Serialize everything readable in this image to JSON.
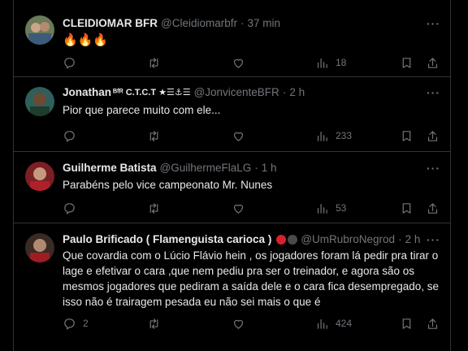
{
  "colors": {
    "background": "#000000",
    "border": "#2f3336",
    "text": "#e7e9ea",
    "muted": "#71767b",
    "accent_red": "#d8202f"
  },
  "action_icons": [
    "reply-icon",
    "retweet-icon",
    "like-icon",
    "views-icon",
    "bookmark-icon",
    "share-icon"
  ],
  "more_label": "···",
  "tweets": [
    {
      "name": "CLEIDIOMAR BFR",
      "handle": "@Cleidiomarbfr",
      "time": "37 min",
      "text": "🔥🔥🔥",
      "replies": "",
      "retweets": "",
      "likes": "",
      "views": "18"
    },
    {
      "name": "Jonathan",
      "name_badges": "ᴮᶠᴿ C.T.C.T ★☰⚓☰",
      "handle": "@JonvicenteBFR",
      "time": "2 h",
      "text": "Pior que parece muito com ele...",
      "replies": "",
      "retweets": "",
      "likes": "",
      "views": "233"
    },
    {
      "name": "Guilherme Batista",
      "handle": "@GuilhermeFlaLG",
      "time": "1 h",
      "text": "Parabéns pelo vice campeonato Mr. Nunes",
      "replies": "",
      "retweets": "",
      "likes": "",
      "views": "53"
    },
    {
      "name": "Paulo Brificado ( Flamenguista carioca )",
      "handle": "@UmRubroNegrod",
      "time": "2 h",
      "text": "Que covardia com o Lúcio Flávio hein , os jogadores foram lá pedir pra tirar o lage e efetivar o cara ,que nem pediu pra ser o treinador, e agora são os mesmos jogadores que pediram a saída dele e o cara fica desempregado, se isso não é trairagem pesada eu não sei mais o que é",
      "replies": "2",
      "retweets": "",
      "likes": "",
      "views": "424"
    }
  ]
}
